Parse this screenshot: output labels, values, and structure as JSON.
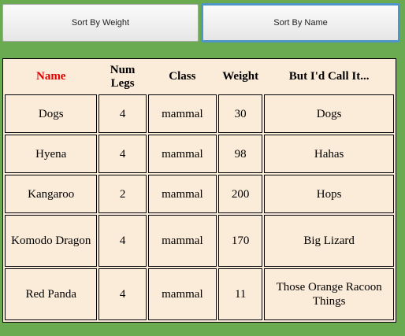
{
  "buttons": {
    "sort_weight": "Sort By Weight",
    "sort_name": "Sort By Name"
  },
  "table": {
    "headers": [
      "Name",
      "Num Legs",
      "Class",
      "Weight",
      "But I'd Call It..."
    ],
    "sorted_column": "Name",
    "rows": [
      [
        "Dogs",
        "4",
        "mammal",
        "30",
        "Dogs"
      ],
      [
        "Hyena",
        "4",
        "mammal",
        "98",
        "Hahas"
      ],
      [
        "Kangaroo",
        "2",
        "mammal",
        "200",
        "Hops"
      ],
      [
        "Komodo Dragon",
        "4",
        "mammal",
        "170",
        "Big Lizard"
      ],
      [
        "Red Panda",
        "4",
        "mammal",
        "11",
        "Those Orange Racoon Things"
      ]
    ]
  },
  "colors": {
    "page_background": "#6aaa50",
    "table_background": "#fbebd9",
    "sorted_header": "#e00000",
    "focus_ring": "#4e95c8"
  }
}
